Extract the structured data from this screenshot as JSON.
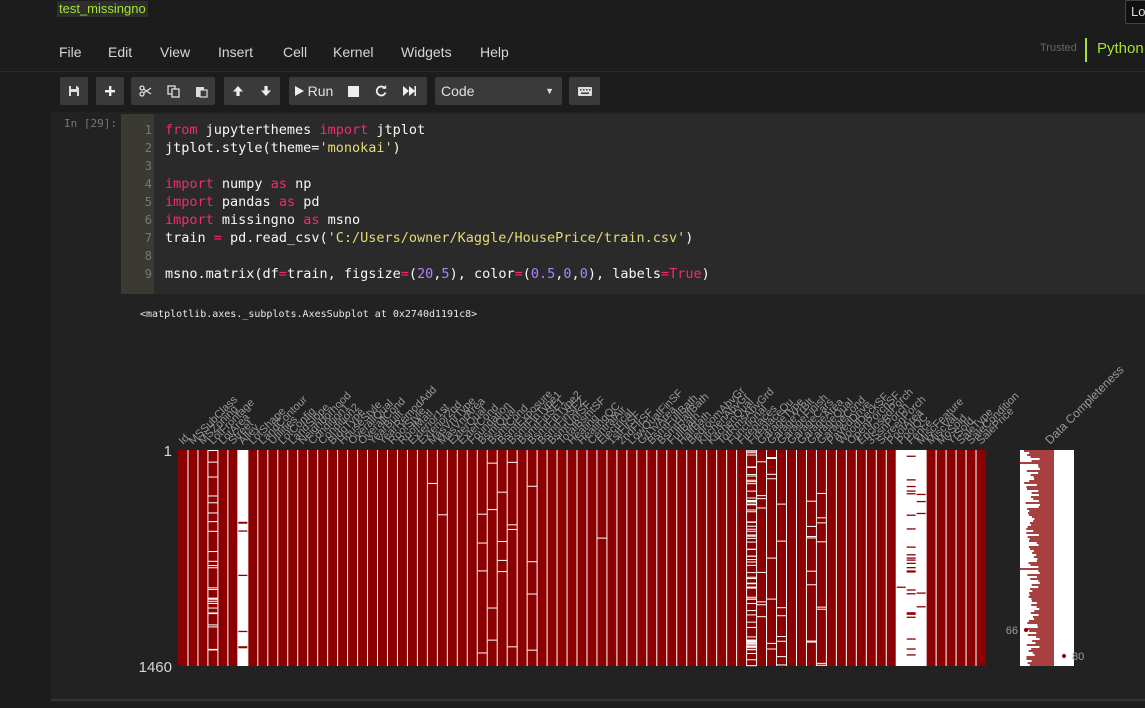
{
  "notebook": {
    "name": "test_missingno",
    "login_label": "Lo"
  },
  "menu": {
    "items": [
      "File",
      "Edit",
      "View",
      "Insert",
      "Cell",
      "Kernel",
      "Widgets",
      "Help"
    ]
  },
  "status": {
    "trusted": "Trusted",
    "kernel": "Python"
  },
  "toolbar": {
    "buttons": [
      "save-icon",
      "plus-icon",
      "cut-icon",
      "copy-icon",
      "paste-icon",
      "arrow-up-icon",
      "arrow-down-icon",
      "play-icon",
      "stop-icon",
      "restart-icon",
      "fast-forward-icon",
      "keyboard-icon"
    ],
    "run_label": "Run",
    "cell_type": "Code"
  },
  "cell": {
    "prompt": "In [29]:",
    "line_numbers": [
      "1",
      "2",
      "3",
      "4",
      "5",
      "6",
      "7",
      "8",
      "9"
    ],
    "code": [
      [
        [
          "kw",
          "from"
        ],
        [
          "",
          " jupyterthemes "
        ],
        [
          "kw",
          "import"
        ],
        [
          "",
          " jtplot"
        ]
      ],
      [
        [
          "",
          "jtplot.style(theme="
        ],
        [
          "str",
          "'monokai'"
        ],
        [
          "",
          ")"
        ]
      ],
      [],
      [
        [
          "kw",
          "import"
        ],
        [
          "",
          " numpy "
        ],
        [
          "kw",
          "as"
        ],
        [
          "",
          " np"
        ]
      ],
      [
        [
          "kw",
          "import"
        ],
        [
          "",
          " pandas "
        ],
        [
          "kw",
          "as"
        ],
        [
          "",
          " pd"
        ]
      ],
      [
        [
          "kw",
          "import"
        ],
        [
          "",
          " missingno "
        ],
        [
          "kw",
          "as"
        ],
        [
          "",
          " msno"
        ]
      ],
      [
        [
          "",
          "train "
        ],
        [
          "kw",
          "="
        ],
        [
          "",
          " pd.read_csv("
        ],
        [
          "str",
          "'C:/Users/owner/Kaggle/HousePrice/train.csv'"
        ],
        [
          "",
          ")"
        ]
      ],
      [],
      [
        [
          "",
          "msno.matrix(df"
        ],
        [
          "kw",
          "="
        ],
        [
          "",
          "train, figsize"
        ],
        [
          "kw",
          "="
        ],
        [
          "",
          "("
        ],
        [
          "num",
          "20"
        ],
        [
          "",
          ","
        ],
        [
          "num",
          "5"
        ],
        [
          "",
          "), color"
        ],
        [
          "kw",
          "="
        ],
        [
          "",
          "("
        ],
        [
          "num",
          "0.5"
        ],
        [
          "",
          ","
        ],
        [
          "num",
          "0"
        ],
        [
          "",
          ","
        ],
        [
          "num",
          "0"
        ],
        [
          "",
          "), labels"
        ],
        [
          "kw",
          "="
        ],
        [
          "kw",
          "True"
        ],
        [
          "",
          ")"
        ]
      ]
    ],
    "output_text": "<matplotlib.axes._subplots.AxesSubplot at 0x2740d1191c8>"
  },
  "chart_data": {
    "type": "heatmap",
    "title": "",
    "y_tick_labels": [
      "1",
      "1460"
    ],
    "row_count": 1460,
    "column_labels": [
      "Id",
      "MSSubClass",
      "MSZoning",
      "LotFrontage",
      "LotArea",
      "Street",
      "Alley",
      "LotShape",
      "LandContour",
      "Utilities",
      "LotConfig",
      "LandSlope",
      "Neighborhood",
      "Condition1",
      "Condition2",
      "BldgType",
      "HouseStyle",
      "OverallQual",
      "OverallCond",
      "YearBuilt",
      "YearRemodAdd",
      "RoofStyle",
      "RoofMatl",
      "Exterior1st",
      "Exterior2nd",
      "MasVnrType",
      "MasVnrArea",
      "ExterQual",
      "ExterCond",
      "Foundation",
      "BsmtQual",
      "BsmtCond",
      "BsmtExposure",
      "BsmtFinType1",
      "BsmtFinSF1",
      "BsmtFinType2",
      "BsmtFinSF2",
      "BsmtUnfSF",
      "TotalBsmtSF",
      "Heating",
      "HeatingQC",
      "CentralAir",
      "Electrical",
      "1stFlrSF",
      "2ndFlrSF",
      "LowQualFinSF",
      "GrLivArea",
      "BsmtFullBath",
      "BsmtHalfBath",
      "FullBath",
      "HalfBath",
      "BedroomAbvGr",
      "KitchenAbvGr",
      "KitchenQual",
      "TotRmsAbvGrd",
      "Functional",
      "Fireplaces",
      "FireplaceQu",
      "GarageType",
      "GarageYrBlt",
      "GarageFinish",
      "GarageCars",
      "GarageArea",
      "GarageQual",
      "GarageCond",
      "PavedDrive",
      "WoodDeckSF",
      "OpenPorchSF",
      "EnclosedPorch",
      "3SsnPorch",
      "ScreenPorch",
      "PoolArea",
      "PoolQC",
      "Fence",
      "MiscFeature",
      "MiscVal",
      "MoSold",
      "YrSold",
      "SaleType",
      "SaleCondition",
      "SalePrice"
    ],
    "missing_fraction": [
      0,
      0,
      0,
      0.18,
      0,
      0,
      0.94,
      0,
      0,
      0,
      0,
      0,
      0,
      0,
      0,
      0,
      0,
      0,
      0,
      0,
      0,
      0,
      0,
      0,
      0,
      0.006,
      0.006,
      0,
      0,
      0,
      0.025,
      0.025,
      0.026,
      0.025,
      0,
      0.026,
      0,
      0,
      0,
      0,
      0,
      0,
      0.001,
      0,
      0,
      0,
      0,
      0,
      0,
      0,
      0,
      0,
      0,
      0,
      0,
      0,
      0,
      0.47,
      0.055,
      0.055,
      0.055,
      0,
      0,
      0.055,
      0.055,
      0,
      0,
      0,
      0,
      0,
      0,
      0,
      0.995,
      0.81,
      0.96,
      0,
      0,
      0,
      0,
      0,
      0
    ],
    "filled_color": "#8b0000",
    "missing_color": "#ffffff",
    "completeness_label": "Data Completeness",
    "completeness_min": "66",
    "completeness_max": "80"
  }
}
